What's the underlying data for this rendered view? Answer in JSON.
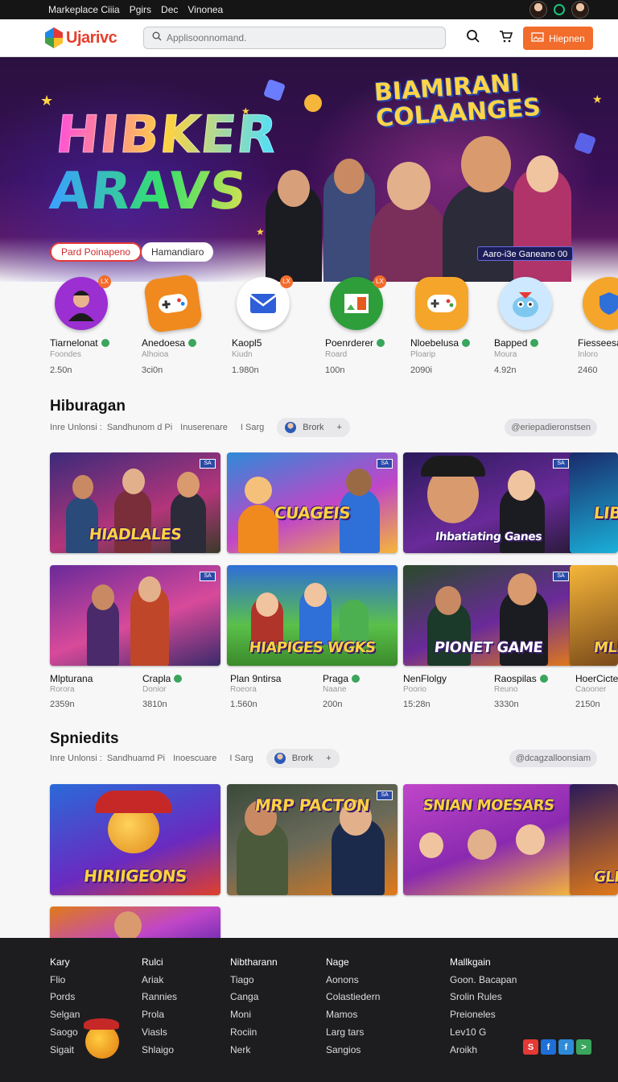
{
  "topbar": {
    "links": [
      "Markeplace Ciiia",
      "Pgirs",
      "Dec",
      "Vinonea"
    ]
  },
  "navbar": {
    "logo_text": "Ujarivc",
    "search_placeholder": "Applisoonnomand.",
    "cta_label": "Hiepnen"
  },
  "hero": {
    "title_line1": "HIBKER",
    "title_line2": "ARAVS",
    "subtitle_line1": "BIAMIRANI",
    "subtitle_line2": "COLAANGES",
    "primary_button": "Pard Poinapeno",
    "secondary_button": "Hamandiaro",
    "badge": "Aaro-i3e Ganeano  00"
  },
  "apps": [
    {
      "name": "Tiarnelonat",
      "sub": "Foondes",
      "count": "2.50n",
      "color": "#9b2fd1"
    },
    {
      "name": "Anedoesa",
      "sub": "Alhoioa",
      "count": "3ci0n",
      "color": "#f08a1f"
    },
    {
      "name": "Kaopl5",
      "sub": "Kiudn",
      "count": "1.980n",
      "color": "#ffffff"
    },
    {
      "name": "Poenrderer",
      "sub": "Roard",
      "count": "100n",
      "color": "#2e9e3a"
    },
    {
      "name": "Nloebelusa",
      "sub": "Ploarip",
      "count": "2090i",
      "color": "#f5a52a"
    },
    {
      "name": "Bapped",
      "sub": "Moura",
      "count": "4.92n",
      "color": "#cde8ff"
    },
    {
      "name": "Fiesseesa",
      "sub": "Inloro",
      "count": "2460",
      "color": "#f5a52a"
    }
  ],
  "section1": {
    "title": "Hiburagan",
    "filters": [
      "Inre Unlonsi :",
      "Sandhunom d Pi",
      "Inuserenare",
      "I Sarg"
    ],
    "pill_label": "Brork",
    "tag": "@eriepadieronstsen",
    "cards_row1": [
      {
        "title": "HIADLALES",
        "flag": "SA"
      },
      {
        "title": "CUAGEIS",
        "flag": "SA"
      },
      {
        "title": "Ihbatiating Ganes",
        "flag": "SA"
      },
      {
        "title": "LIB",
        "flag": ""
      }
    ],
    "cards_row2": [
      {
        "title": "",
        "flag": "SA"
      },
      {
        "title": "HIAPIGES WGKS",
        "flag": ""
      },
      {
        "title": "PIONET GAME",
        "flag": "SA"
      },
      {
        "title": "MLI",
        "flag": ""
      }
    ],
    "meta": [
      {
        "name": "Mlpturana",
        "sub": "Rorora",
        "count": "2359n"
      },
      {
        "name": "Craplа",
        "sub": "Donior",
        "count": "3810n"
      },
      {
        "name": "Plan 9ntirsa",
        "sub": "Roeora",
        "count": "1.560n"
      },
      {
        "name": "Praga",
        "sub": "Naane",
        "count": "200n"
      },
      {
        "name": "NenFlolgy",
        "sub": "Poorio",
        "count": "15:28n"
      },
      {
        "name": "Raospilas",
        "sub": "Reuno",
        "count": "3330n"
      },
      {
        "name": "HoerCicter",
        "sub": "Caooner",
        "count": "2150n"
      }
    ]
  },
  "section2": {
    "title": "Spniedits",
    "filters": [
      "Inre Unlonsi :",
      "Sandhuamd Pi",
      "Inoescuare",
      "I Sarg"
    ],
    "pill_label": "Brork",
    "tag": "@dcagzalloonsiam",
    "cards": [
      {
        "title": "HIRIIGEONS",
        "flag": ""
      },
      {
        "title": "MRP PACTON",
        "flag": "SA"
      },
      {
        "title": "SNIAN MOESARS",
        "flag": ""
      },
      {
        "title": "GLIG",
        "flag": ""
      }
    ]
  },
  "footer": {
    "columns": [
      [
        "Kary",
        "Flio",
        "Pords",
        "Selgan",
        "Saogo",
        "Sigait"
      ],
      [
        "Rulci",
        "Ariak",
        "Rannies",
        "Prola",
        "Viasls",
        "Shlaigo"
      ],
      [
        "Nibtharann",
        "Tiago",
        "Canga",
        "Moni",
        "Rociin",
        "Nerk"
      ],
      [
        "Nage",
        "Aonons",
        "Colastiedern",
        "Mamos",
        "Larg tars",
        "Sangios"
      ],
      [
        "Mallkgain",
        "Goon. Bacapan",
        "Srolin Rules",
        "Preioneles",
        "Lev10 G",
        "Aroikh"
      ]
    ],
    "social": [
      "S",
      "f",
      "f",
      ">"
    ]
  }
}
